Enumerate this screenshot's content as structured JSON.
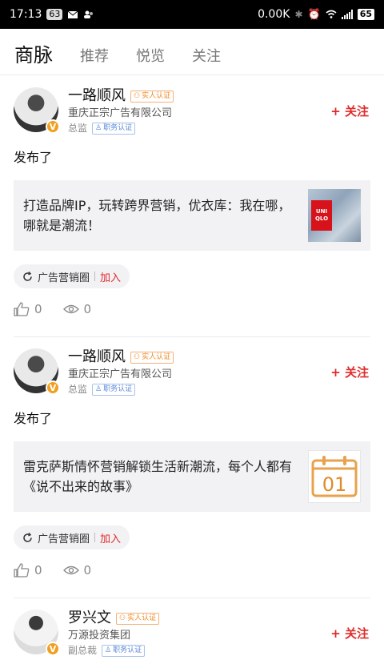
{
  "status_bar": {
    "time": "17:13",
    "notif_count": "63",
    "net_speed": "0.00K",
    "battery": "65"
  },
  "tabs": {
    "main": "商脉",
    "items": [
      "推荐",
      "悦览",
      "关注"
    ]
  },
  "posts": [
    {
      "user": {
        "name": "一路顺风",
        "verify_tag": "实人认证",
        "company": "重庆正宗广告有限公司",
        "title": "总监",
        "job_tag": "职务认证",
        "badge": "V"
      },
      "follow_label": "+ 关注",
      "action_text": "发布了",
      "link_title": "打造品牌IP，玩转跨界营销，优衣库：我在哪，哪就是潮流！",
      "thumb_text": "UNI QLO",
      "circle": {
        "name": "广告营销圈",
        "join": "加入"
      },
      "likes": "0",
      "views": "0"
    },
    {
      "user": {
        "name": "一路顺风",
        "verify_tag": "实人认证",
        "company": "重庆正宗广告有限公司",
        "title": "总监",
        "job_tag": "职务认证",
        "badge": "V"
      },
      "follow_label": "+ 关注",
      "action_text": "发布了",
      "link_title": "雷克萨斯情怀营销解锁生活新潮流，每个人都有《说不出来的故事》",
      "thumb_text": "01",
      "circle": {
        "name": "广告营销圈",
        "join": "加入"
      },
      "likes": "0",
      "views": "0"
    },
    {
      "user": {
        "name": "罗兴文",
        "verify_tag": "实人认证",
        "company": "万源投资集团",
        "title": "副总裁",
        "job_tag": "职务认证",
        "badge": "V"
      },
      "follow_label": "+ 关注"
    }
  ]
}
